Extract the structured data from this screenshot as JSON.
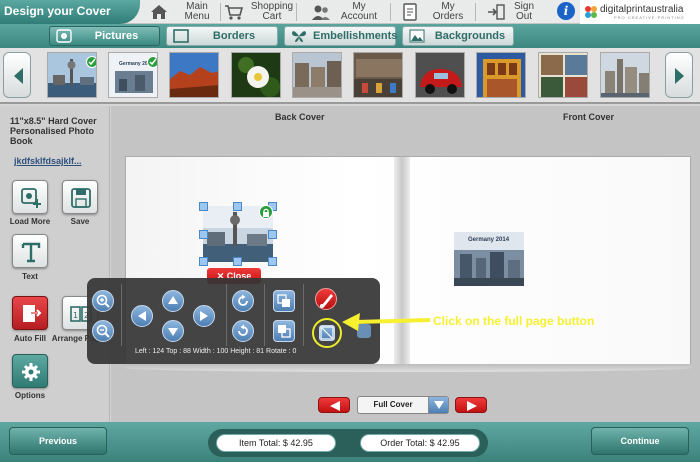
{
  "header": {
    "app_title": "Design your Cover",
    "nav": [
      {
        "label": "Main\nMenu",
        "icon": "home-icon"
      },
      {
        "label": "Shopping\nCart",
        "icon": "cart-icon"
      },
      {
        "label": "My\nAccount",
        "icon": "account-icon"
      },
      {
        "label": "My\nOrders",
        "icon": "orders-icon"
      },
      {
        "label": "Sign\nOut",
        "icon": "sign-out-icon"
      }
    ],
    "info_label": "i",
    "brand_name": "digitalprintaustralia",
    "brand_tagline": "PRO CREATIVE PRINTING"
  },
  "tabs": [
    {
      "label": "Pictures",
      "icon": "pictures-icon",
      "active": true
    },
    {
      "label": "Borders",
      "icon": "borders-icon",
      "active": false
    },
    {
      "label": "Embellishments",
      "icon": "butterfly-icon",
      "active": false
    },
    {
      "label": "Backgrounds",
      "icon": "backgrounds-icon",
      "active": false
    }
  ],
  "thumbnails": [
    {
      "scene": "harbour-tower",
      "used": true
    },
    {
      "scene": "germany-2014",
      "used": true,
      "caption": "Germany 2014"
    },
    {
      "scene": "red-rock"
    },
    {
      "scene": "white-flower"
    },
    {
      "scene": "city-square"
    },
    {
      "scene": "street-market"
    },
    {
      "scene": "vintage-car"
    },
    {
      "scene": "building-facade"
    },
    {
      "scene": "collage"
    },
    {
      "scene": "cathedral-skyline"
    }
  ],
  "sidebar": {
    "product_name": "11\"x8.5\" Hard Cover Personalised Photo Book",
    "project_name": "jkdfsklfdsajklf...",
    "buttons": [
      {
        "label": "Load More",
        "icon": "load-more-icon"
      },
      {
        "label": "Save",
        "icon": "save-icon"
      },
      {
        "label": "Text",
        "icon": "text-icon"
      },
      {
        "label": "Auto Fill",
        "icon": "auto-fill-icon"
      },
      {
        "label": "Arrange Pages",
        "icon": "arrange-pages-icon"
      },
      {
        "label": "Options",
        "icon": "gear-icon"
      }
    ]
  },
  "cover": {
    "back_label": "Back Cover",
    "front_label": "Front Cover",
    "close_label": "Close",
    "front_photo_caption": "Germany 2014"
  },
  "toolbar": {
    "info": "Left : 124  Top : 88  Width : 100  Height : 81  Rotate : 0"
  },
  "annotation": {
    "text": "Click on the full page button",
    "color": "#f6f030"
  },
  "page_nav": {
    "selected": "Full Cover"
  },
  "footer": {
    "previous_label": "Previous",
    "continue_label": "Continue",
    "item_total": "Item Total: $ 42.95",
    "order_total": "Order Total: $ 42.95"
  },
  "colors": {
    "accent": "#3c8780",
    "danger": "#c41111",
    "highlight": "#ecec2a"
  }
}
